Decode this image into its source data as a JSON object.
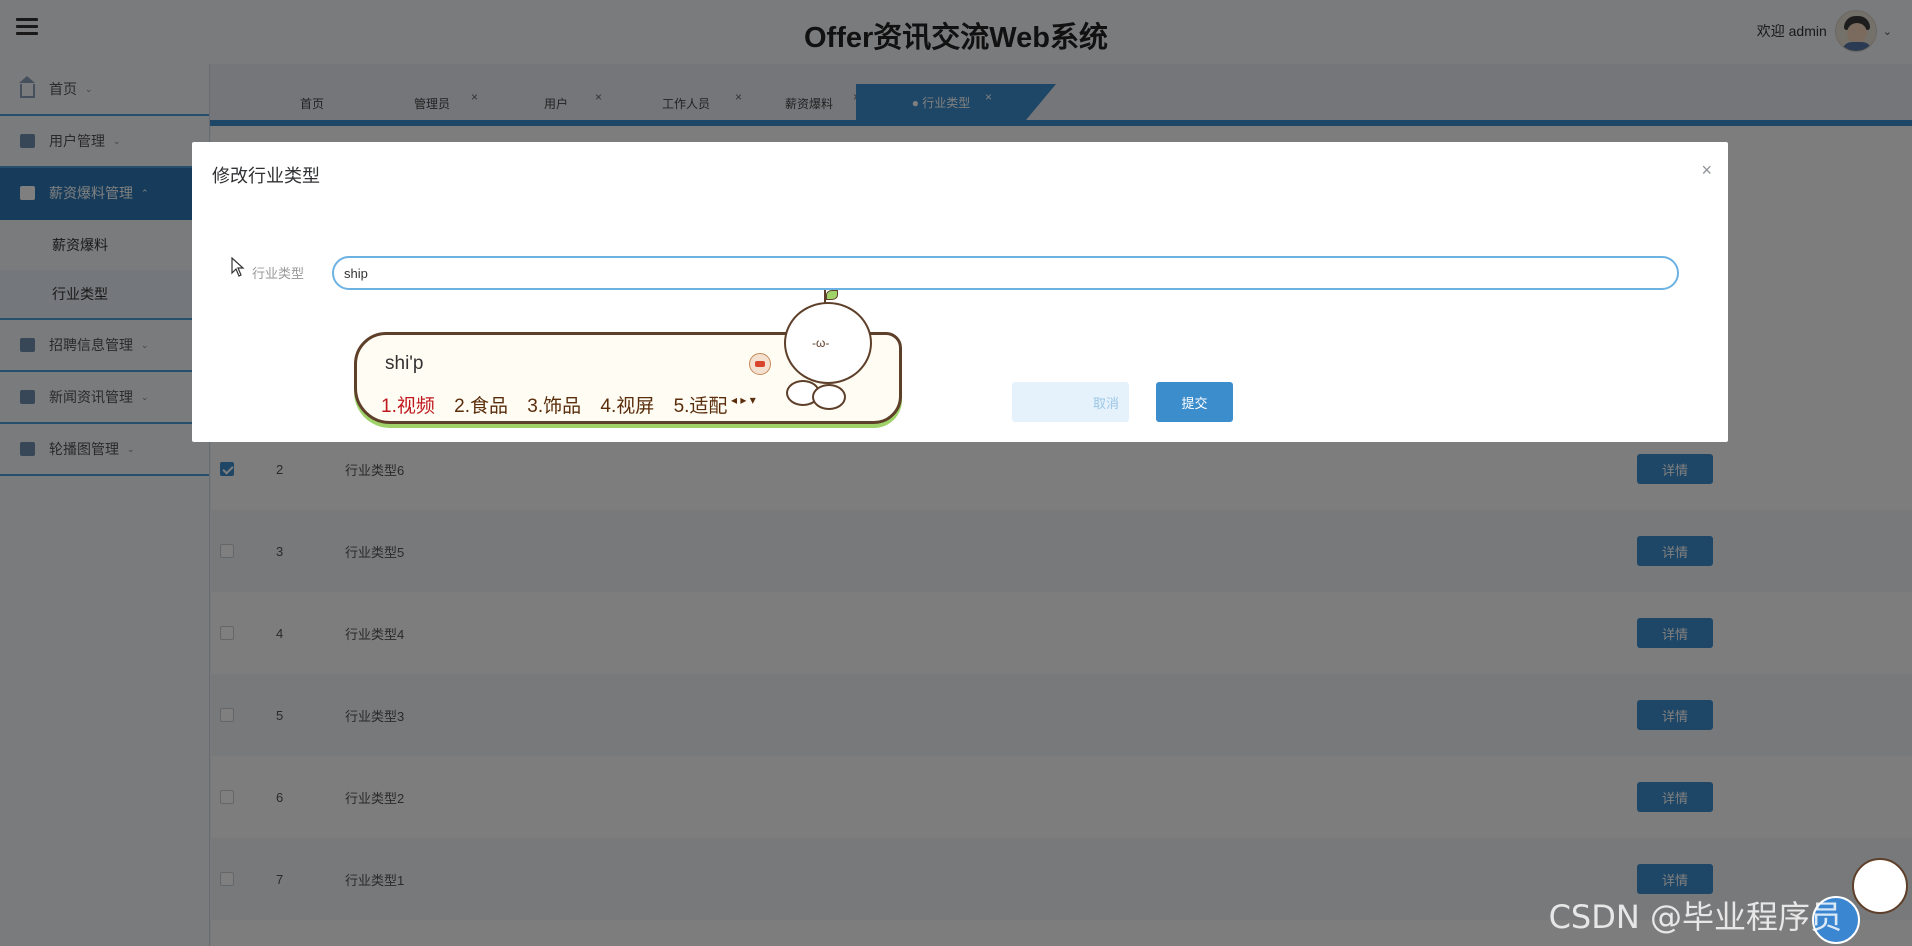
{
  "header": {
    "title": "Offer资讯交流Web系统",
    "welcome": "欢迎 admin",
    "caret": "⌄"
  },
  "sidebar": {
    "items": [
      {
        "label": "首页",
        "arrow": "⌄"
      },
      {
        "label": "用户管理",
        "arrow": "⌄"
      },
      {
        "label": "薪资爆料管理",
        "arrow": "⌃"
      },
      {
        "label": "招聘信息管理",
        "arrow": "⌄"
      },
      {
        "label": "新闻资讯管理",
        "arrow": "⌄"
      },
      {
        "label": "轮播图管理",
        "arrow": "⌄"
      }
    ],
    "subitems": [
      {
        "label": "薪资爆料"
      },
      {
        "label": "行业类型"
      }
    ]
  },
  "tabs": [
    {
      "label": "首页",
      "close": ""
    },
    {
      "label": "管理员",
      "close": "×"
    },
    {
      "label": "用户",
      "close": "×"
    },
    {
      "label": "工作人员",
      "close": "×"
    },
    {
      "label": "薪资爆料",
      "close": "×"
    },
    {
      "label": "● 行业类型",
      "close": "×"
    }
  ],
  "table": {
    "rows": [
      {
        "index": "2",
        "name": "行业类型6",
        "checked": true,
        "action": "详情"
      },
      {
        "index": "3",
        "name": "行业类型5",
        "checked": false,
        "action": "详情"
      },
      {
        "index": "4",
        "name": "行业类型4",
        "checked": false,
        "action": "详情"
      },
      {
        "index": "5",
        "name": "行业类型3",
        "checked": false,
        "action": "详情"
      },
      {
        "index": "6",
        "name": "行业类型2",
        "checked": false,
        "action": "详情"
      },
      {
        "index": "7",
        "name": "行业类型1",
        "checked": false,
        "action": "详情"
      }
    ]
  },
  "dialog": {
    "title": "修改行业类型",
    "close": "×",
    "field_label": "行业类型",
    "field_value": "ship",
    "cancel_label": "取消",
    "submit_label": "提交"
  },
  "ime": {
    "input": "shi'p",
    "candidates": [
      "1.视频",
      "2.食品",
      "3.饰品",
      "4.视屏",
      "5.适配"
    ],
    "nav": "◂ ▸ ▾",
    "mascot_face": "-ω-"
  },
  "watermark": "CSDN @毕业程序员",
  "colors": {
    "accent": "#3c8dcc",
    "sidebar_active": "#2f79b6",
    "ime_highlight": "#c0181f"
  }
}
